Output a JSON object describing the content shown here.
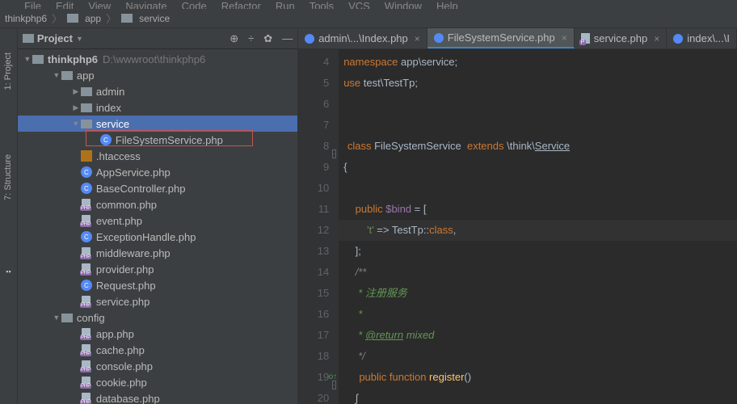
{
  "menu": [
    "File",
    "Edit",
    "View",
    "Navigate",
    "Code",
    "Refactor",
    "Run",
    "Tools",
    "VCS",
    "Window",
    "Help"
  ],
  "breadcrumb": {
    "root": "thinkphp6",
    "app": "app",
    "service": "service"
  },
  "leftTabs": {
    "project": "1: Project",
    "structure": "7: Structure"
  },
  "panel": {
    "title": "Project",
    "path": "D:\\wwwroot\\thinkphp6"
  },
  "tree": {
    "root": "thinkphp6",
    "app": "app",
    "admin": "admin",
    "index": "index",
    "service": "service",
    "fss": "FileSystemService.php",
    "ht": ".htaccess",
    "apps": "AppService.php",
    "bc": "BaseController.php",
    "common": "common.php",
    "event": "event.php",
    "exh": "ExceptionHandle.php",
    "mw": "middleware.php",
    "prov": "provider.php",
    "req": "Request.php",
    "svc": "service.php",
    "config": "config",
    "appphp": "app.php",
    "cache": "cache.php",
    "console": "console.php",
    "cookie": "cookie.php",
    "db": "database.php"
  },
  "tabs": {
    "t1": "admin\\...\\Index.php",
    "t2": "FileSystemService.php",
    "t3": "service.php",
    "t4": "index\\...\\I"
  },
  "lines": [
    "4",
    "5",
    "6",
    "7",
    "8",
    "9",
    "10",
    "11",
    "12",
    "13",
    "14",
    "15",
    "16",
    "17",
    "18",
    "19",
    "20"
  ],
  "code": {
    "ns": "namespace ",
    "nsp": "app\\service",
    "use": "use ",
    "usep": "test\\TestTp",
    "class": "class ",
    "cname": "FileSystemService",
    "ext": "  extends ",
    "ep": "\\think\\",
    "svc": "Service",
    "pub": "public ",
    "bind": "$bind",
    "eq": " = [",
    "key": "'t'",
    "arrow": " => TestTp::",
    "cl": "class",
    "close": "];",
    "c1": "/**",
    "c2": " * 注册服务",
    "c3": " *",
    "c4": " * ",
    "ret": "@return",
    "mix": " mixed",
    "c5": " */",
    "fn": "function ",
    "reg": "register",
    "paren": "()"
  }
}
